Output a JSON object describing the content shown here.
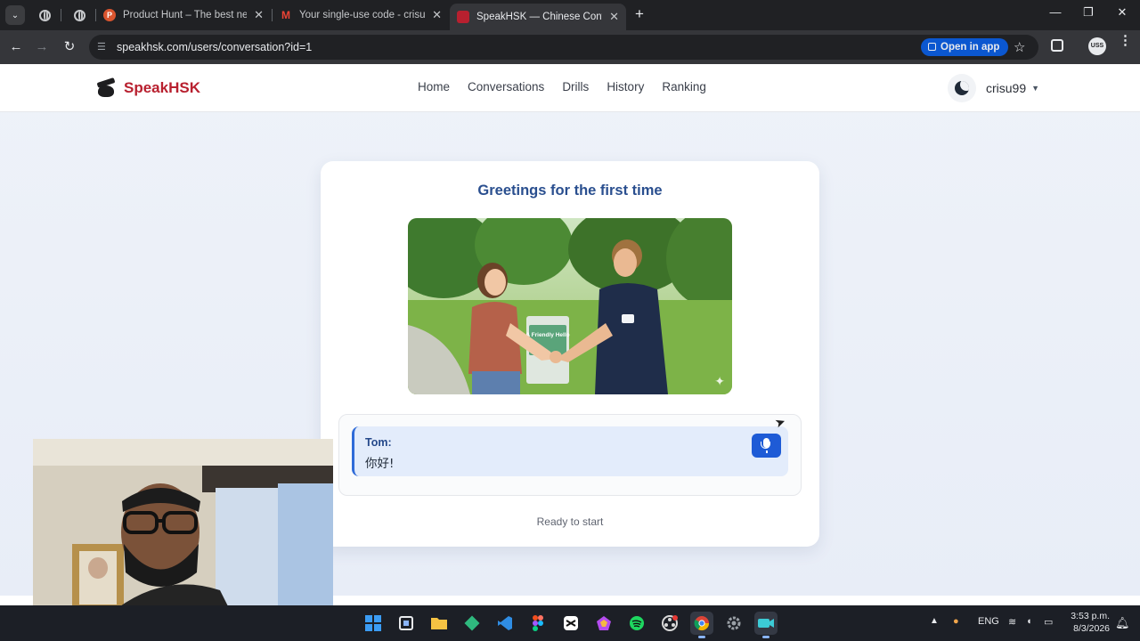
{
  "browser": {
    "tabs": [
      {
        "title": "Product Hunt – The best new p",
        "favicon_color": "#da552f",
        "favicon_letter": "P"
      },
      {
        "title": "Your single-use code - crisutat",
        "favicon_color": "#ea4335",
        "favicon_letter": "M"
      },
      {
        "title": "SpeakHSK — Chinese Conversa",
        "favicon_color": "#b8202f",
        "favicon_letter": ""
      }
    ],
    "url": "speakhsk.com/users/conversation?id=1",
    "open_in_app_label": "Open in app",
    "profile_initials": "USS"
  },
  "site": {
    "brand": "SpeakHSK",
    "nav": [
      "Home",
      "Conversations",
      "Drills",
      "History",
      "Ranking"
    ],
    "username": "crisu99"
  },
  "conversation": {
    "title": "Greetings for the first time",
    "image_sign_text": "A Friendly Hello",
    "speaker": "Tom:",
    "utterance": "你好!",
    "status": "Ready to start"
  },
  "taskbar": {
    "apps": [
      {
        "name": "windows-start-icon",
        "color": "#3b9cf4"
      },
      {
        "name": "snipping-tool-icon",
        "color": "#e8eaed"
      },
      {
        "name": "file-explorer-icon",
        "color": "#f6c343"
      },
      {
        "name": "git-kraken-icon",
        "color": "#2fb97e"
      },
      {
        "name": "vscode-icon",
        "color": "#2f8de4"
      },
      {
        "name": "figma-icon",
        "color": "#f24e1e"
      },
      {
        "name": "capcut-icon",
        "color": "#ffffff"
      },
      {
        "name": "prism-app-icon",
        "color": "#b54cf0"
      },
      {
        "name": "spotify-icon",
        "color": "#1ed760"
      },
      {
        "name": "obs-icon",
        "color": "#d9d9d9"
      },
      {
        "name": "chrome-icon",
        "color": "#4285f4"
      },
      {
        "name": "settings-icon",
        "color": "#9aa0a6"
      },
      {
        "name": "screen-recorder-icon",
        "color": "#3ccbd6"
      }
    ],
    "language": "ENG",
    "time": "3:53 p.m.",
    "date": "8/3/2026"
  }
}
